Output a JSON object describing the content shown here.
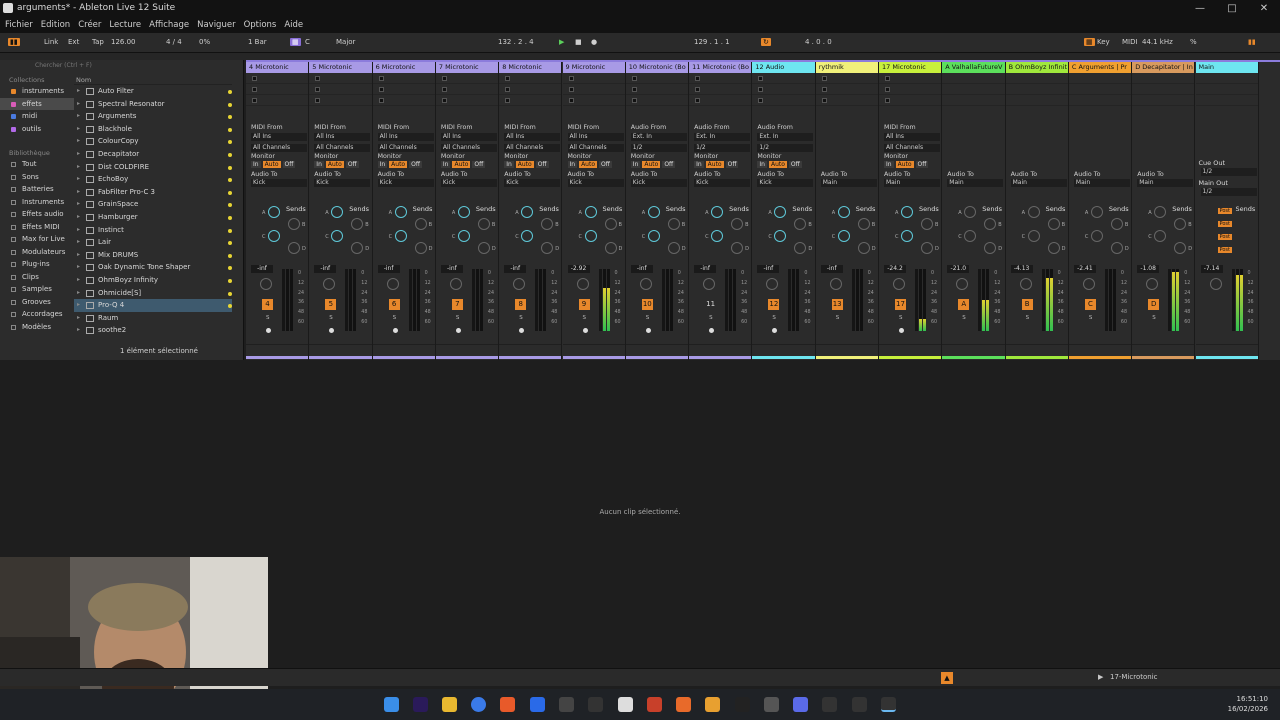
{
  "window": {
    "title": "arguments* - Ableton Live 12 Suite",
    "controls": [
      "—",
      "□",
      "✕"
    ]
  },
  "menu": [
    "Fichier",
    "Edition",
    "Créer",
    "Lecture",
    "Affichage",
    "Naviguer",
    "Options",
    "Aide"
  ],
  "control_bar": {
    "link": "Link",
    "ext": "Ext",
    "tap": "Tap",
    "tempo": "126.00",
    "time_sig": "4 / 4",
    "swing": "0%",
    "quantize": "1 Bar",
    "key": "C",
    "scale": "Major",
    "position": "132 .   2 .   4",
    "loop_start": "129 .   1 .   1",
    "loop_length": "4 .   0 .   0",
    "key_btn": "Key",
    "midi_btn": "MIDI",
    "sample_rate": "44.1 kHz",
    "cpu": "%"
  },
  "browser": {
    "search_placeholder": "Chercher (Ctrl + F)",
    "collections_header": "Collections",
    "collections": [
      {
        "label": "instruments",
        "color": "#e8882b"
      },
      {
        "label": "effets",
        "color": "#d95cb8",
        "selected": true
      },
      {
        "label": "midi",
        "color": "#4a7ae0"
      },
      {
        "label": "outils",
        "color": "#b26ae8"
      }
    ],
    "library_header": "Bibliothèque",
    "library": [
      "Tout",
      "Sons",
      "Batteries",
      "Instruments",
      "Effets audio",
      "Effets MIDI",
      "Max for Live",
      "Modulateurs",
      "Plug-ins",
      "Clips",
      "Samples",
      "Grooves",
      "Accordages",
      "Modèles"
    ],
    "name_header": "Nom",
    "items": [
      "Auto Filter",
      "Spectral Resonator",
      "Arguments",
      "Blackhole",
      "ColourCopy",
      "Decapitator",
      "Dist COLDFIRE",
      "EchoBoy",
      "FabFilter Pro-C 3",
      "GrainSpace",
      "Hamburger",
      "Instinct",
      "Lair",
      "Mix DRUMS",
      "Oak Dynamic Tone Shaper",
      "OhmBoyz Infinity",
      "Ohmicide[S]",
      "Pro-Q 4",
      "Raum",
      "soothe2"
    ],
    "selected_item": "Pro-Q 4",
    "status": "1 élément sélectionné"
  },
  "tracks": [
    {
      "name": "4 Microtonic",
      "color": "#a89ae6",
      "type": "midi",
      "from": "MIDI From",
      "from_val": "All Ins",
      "ch": "All Channels",
      "to": "Kick",
      "vol": "-inf",
      "num": "4",
      "meter": 0
    },
    {
      "name": "5 Microtonic",
      "color": "#a89ae6",
      "type": "midi",
      "from": "MIDI From",
      "from_val": "All Ins",
      "ch": "All Channels",
      "to": "Kick",
      "vol": "-inf",
      "num": "5",
      "meter": 0
    },
    {
      "name": "6 Microtonic",
      "color": "#a89ae6",
      "type": "midi",
      "from": "MIDI From",
      "from_val": "All Ins",
      "ch": "All Channels",
      "to": "Kick",
      "vol": "-inf",
      "num": "6",
      "meter": 0
    },
    {
      "name": "7 Microtonic",
      "color": "#a89ae6",
      "type": "midi",
      "from": "MIDI From",
      "from_val": "All Ins",
      "ch": "All Channels",
      "to": "Kick",
      "vol": "-inf",
      "num": "7",
      "meter": 0
    },
    {
      "name": "8 Microtonic",
      "color": "#a89ae6",
      "type": "midi",
      "from": "MIDI From",
      "from_val": "All Ins",
      "ch": "All Channels",
      "to": "Kick",
      "vol": "-inf",
      "num": "8",
      "meter": 0
    },
    {
      "name": "9 Microtonic",
      "color": "#a89ae6",
      "type": "midi",
      "from": "MIDI From",
      "from_val": "All Ins",
      "ch": "All Channels",
      "to": "Kick",
      "vol": "-2.92",
      "num": "9",
      "meter": 0.7
    },
    {
      "name": "10 Microtonic (Bo",
      "color": "#a89ae6",
      "type": "audio",
      "from": "Audio From",
      "from_val": "Ext. In",
      "ch": "1/2",
      "to": "Kick",
      "vol": "-inf",
      "num": "10",
      "meter": 0
    },
    {
      "name": "11 Microtonic (Bo",
      "color": "#a89ae6",
      "type": "audio",
      "from": "Audio From",
      "from_val": "Ext. In",
      "ch": "1/2",
      "to": "Kick",
      "vol": "-inf",
      "num": "11",
      "meter": 0
    },
    {
      "name": "12 Audio",
      "color": "#6ee6f0",
      "type": "audio",
      "from": "Audio From",
      "from_val": "Ext. In",
      "ch": "1/2",
      "to": "Kick",
      "vol": "-inf",
      "num": "12",
      "meter": 0
    },
    {
      "name": "rythmik",
      "color": "#f0f07a",
      "type": "group",
      "to": "Main",
      "vol": "-inf",
      "num": "13",
      "meter": 0
    },
    {
      "name": "17 Microtonic",
      "color": "#c8f03c",
      "type": "midi",
      "from": "MIDI From",
      "from_val": "All Ins",
      "ch": "All Channels",
      "to": "Main",
      "vol": "-24.2",
      "num": "17",
      "meter": 0.2
    },
    {
      "name": "A ValhallaFutureV",
      "color": "#5ce05c",
      "type": "return",
      "to": "Main",
      "vol": "-21.0",
      "num": "A",
      "meter": 0.5
    },
    {
      "name": "B OhmBoyz Infinit",
      "color": "#a0e83c",
      "type": "return",
      "to": "Main",
      "vol": "-4.13",
      "num": "B",
      "meter": 0.85
    },
    {
      "name": "C Arguments | Pr",
      "color": "#f0a030",
      "type": "return",
      "to": "Main",
      "vol": "-2.41",
      "num": "C",
      "meter": 0
    },
    {
      "name": "D Decapitator | In",
      "color": "#d89a5e",
      "type": "return",
      "to": "Main",
      "vol": "-1.08",
      "num": "D",
      "meter": 0.95
    },
    {
      "name": "Main",
      "color": "#6ee6f0",
      "type": "main",
      "to": "",
      "vol": "-7.14",
      "num": "",
      "meter": 0.9
    }
  ],
  "labels": {
    "audio_to": "Audio To",
    "monitor": "Monitor",
    "in": "In",
    "auto": "Auto",
    "off": "Off",
    "sends": "Sends",
    "cue_out": "Cue Out",
    "main_out": "Main Out",
    "cue_val": "1/2",
    "main_val": "1/2",
    "post": "Post",
    "scale": [
      "0",
      "12",
      "24",
      "36",
      "48",
      "60"
    ]
  },
  "clip_view": {
    "message": "Aucun clip sélectionné."
  },
  "status_bar": {
    "track_name": "17-Microtonic"
  },
  "tray": {
    "time": "16:51:10",
    "date": "16/02/2026"
  }
}
